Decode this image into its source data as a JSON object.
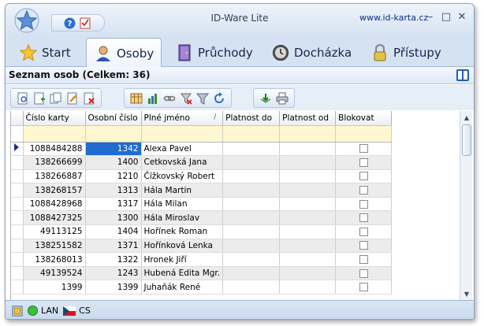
{
  "window": {
    "title": "ID-Ware Lite",
    "url": "www.id-karta.cz",
    "minimize": "–",
    "maximize": "□",
    "close": "✕"
  },
  "tabs": [
    {
      "label": "Start",
      "icon": "star-icon"
    },
    {
      "label": "Osoby",
      "icon": "person-icon"
    },
    {
      "label": "Průchody",
      "icon": "door-icon"
    },
    {
      "label": "Docházka",
      "icon": "clock-icon"
    },
    {
      "label": "Přístupy",
      "icon": "lock-icon"
    }
  ],
  "active_tab": "Osoby",
  "panel": {
    "title": "Seznam osob (Celkem: 36)"
  },
  "grid": {
    "columns": [
      "Číslo karty",
      "Osobní číslo",
      "Plné jméno",
      "Platnost do",
      "Platnost od",
      "Blokovat"
    ],
    "sorted_column": "Plné jméno",
    "rows": [
      {
        "card": "1088484288",
        "personal": "1342",
        "name": "Alexa Pavel",
        "valid_to": "",
        "valid_from": "",
        "blocked": false
      },
      {
        "card": "138266699",
        "personal": "1400",
        "name": "Cetkovská Jana",
        "valid_to": "",
        "valid_from": "",
        "blocked": false
      },
      {
        "card": "138266887",
        "personal": "1210",
        "name": "Čížkovský Robert",
        "valid_to": "",
        "valid_from": "",
        "blocked": false
      },
      {
        "card": "138268157",
        "personal": "1313",
        "name": "Hála Martin",
        "valid_to": "",
        "valid_from": "",
        "blocked": false
      },
      {
        "card": "1088428968",
        "personal": "1317",
        "name": "Hála Milan",
        "valid_to": "",
        "valid_from": "",
        "blocked": false
      },
      {
        "card": "1088427325",
        "personal": "1300",
        "name": "Hála Miroslav",
        "valid_to": "",
        "valid_from": "",
        "blocked": false
      },
      {
        "card": "49113125",
        "personal": "1404",
        "name": "Hořínek Roman",
        "valid_to": "",
        "valid_from": "",
        "blocked": false
      },
      {
        "card": "138251582",
        "personal": "1371",
        "name": "Hořínková Lenka",
        "valid_to": "",
        "valid_from": "",
        "blocked": false
      },
      {
        "card": "138268013",
        "personal": "1322",
        "name": "Hronek Jiří",
        "valid_to": "",
        "valid_from": "",
        "blocked": false
      },
      {
        "card": "49139524",
        "personal": "1243",
        "name": "Hubená Edita Mgr.",
        "valid_to": "",
        "valid_from": "",
        "blocked": false
      },
      {
        "card": "1399",
        "personal": "1399",
        "name": "Juhaňák René",
        "valid_to": "",
        "valid_from": "",
        "blocked": false
      }
    ]
  },
  "statusbar": {
    "connection": "LAN",
    "language": "CS"
  },
  "colors": {
    "selection": "#1f6bd0",
    "filter_row": "#fff7cf",
    "accent": "#1f5fb0"
  }
}
